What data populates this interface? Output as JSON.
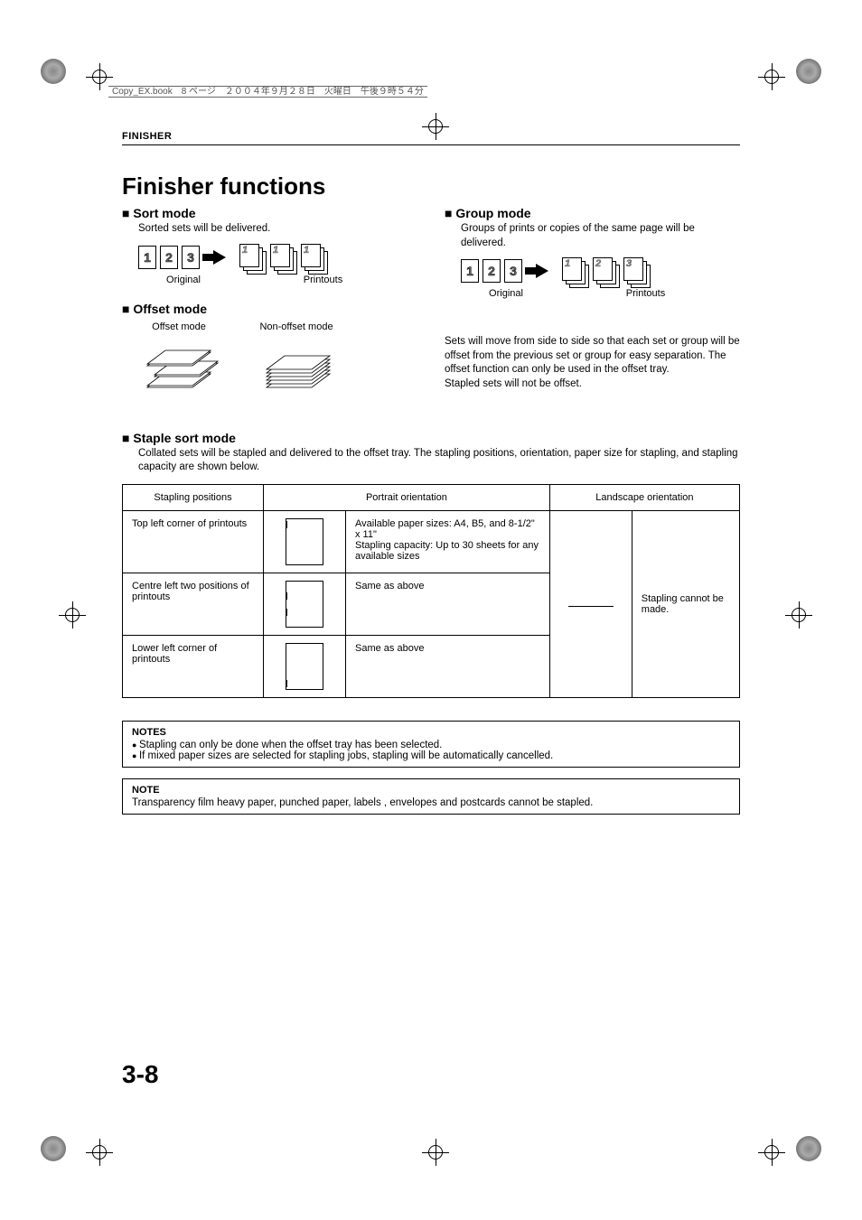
{
  "header_line": "Copy_EX.book　8 ページ　２００４年９月２８日　火曜日　午後９時５４分",
  "section": "FINISHER",
  "title": "Finisher functions",
  "sort": {
    "head": "Sort mode",
    "desc": "Sorted sets will be delivered.",
    "orig_label": "Original",
    "print_label": "Printouts"
  },
  "group": {
    "head": "Group mode",
    "desc": "Groups of prints or copies of the same page will be delivered.",
    "orig_label": "Original",
    "print_label": "Printouts"
  },
  "offset": {
    "head": "Offset mode",
    "offset_label": "Offset mode",
    "nonoffset_label": "Non-offset mode",
    "para": "Sets will move from side to side so that each set or group will be offset from the previous set or group for easy separation. The offset function can only be used in the offset tray.\nStapled sets will not be offset."
  },
  "staple": {
    "head": "Staple sort mode",
    "intro": "Collated sets will be stapled and delivered to the offset tray. The stapling positions, orientation, paper size for stapling, and stapling capacity are shown below.",
    "th_positions": "Stapling positions",
    "th_portrait": "Portrait orientation",
    "th_landscape": "Landscape orientation",
    "rows": [
      {
        "pos": "Top left corner of printouts",
        "portrait_text": "Available paper sizes: A4, B5, and 8-1/2\" x 11\"\nStapling capacity: Up to 30 sheets for any available sizes"
      },
      {
        "pos": "Centre left two positions of printouts",
        "portrait_text": "Same as above"
      },
      {
        "pos": "Lower left corner of printouts",
        "portrait_text": "Same as above"
      }
    ],
    "landscape_text": "Stapling cannot be made."
  },
  "notes1": {
    "title": "NOTES",
    "lines": [
      "Stapling can only be done when the offset tray has been selected.",
      "If mixed paper sizes are selected for stapling jobs, stapling will be automatically cancelled."
    ]
  },
  "notes2": {
    "title": "NOTE",
    "line": "Transparency film heavy paper, punched paper, labels , envelopes and postcards cannot be stapled."
  },
  "page_number": "3-8"
}
